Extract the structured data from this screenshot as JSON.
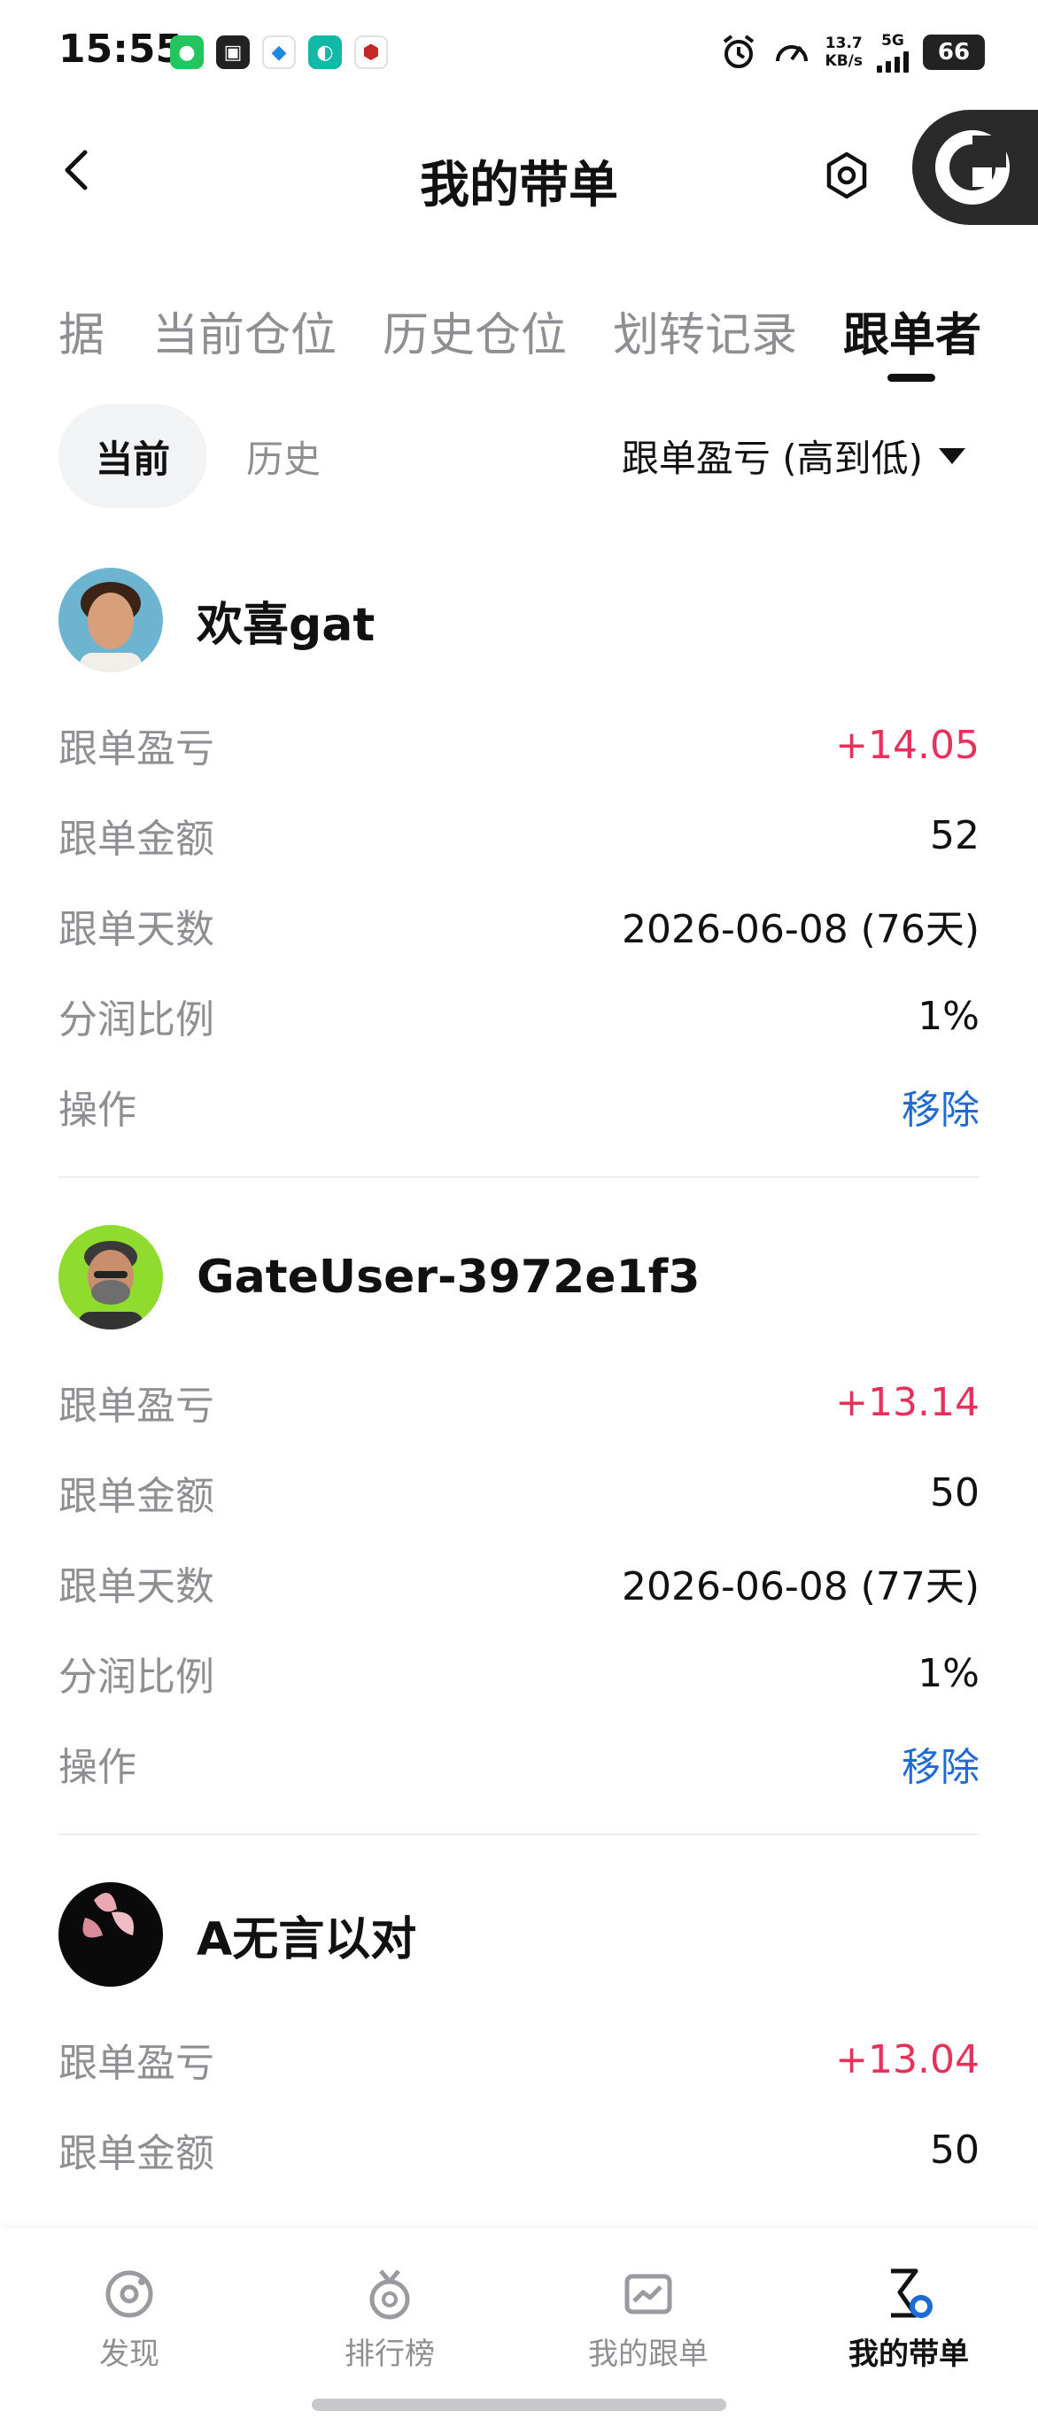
{
  "status_bar": {
    "time": "15:55",
    "net_speed_value": "13.7",
    "net_speed_unit": "KB/s",
    "network_type": "5G",
    "battery": "66"
  },
  "header": {
    "title": "我的带单"
  },
  "tabs": [
    {
      "label": "据"
    },
    {
      "label": "当前仓位"
    },
    {
      "label": "历史仓位"
    },
    {
      "label": "划转记录"
    },
    {
      "label": "跟单者"
    }
  ],
  "filter": {
    "current_label": "当前",
    "history_label": "历史",
    "sort_label": "跟单盈亏 (高到低)"
  },
  "followers": [
    {
      "name": "欢喜gat",
      "rows": [
        {
          "label": "跟单盈亏",
          "value": "+14.05"
        },
        {
          "label": "跟单金额",
          "value": "52"
        },
        {
          "label": "跟单天数",
          "value": "2026-06-08 (76天)"
        },
        {
          "label": "分润比例",
          "value": "1%"
        },
        {
          "label": "操作",
          "value": "移除"
        }
      ]
    },
    {
      "name": "GateUser-3972e1f3",
      "rows": [
        {
          "label": "跟单盈亏",
          "value": "+13.14"
        },
        {
          "label": "跟单金额",
          "value": "50"
        },
        {
          "label": "跟单天数",
          "value": "2026-06-08 (77天)"
        },
        {
          "label": "分润比例",
          "value": "1%"
        },
        {
          "label": "操作",
          "value": "移除"
        }
      ]
    },
    {
      "name": "A无言以对",
      "rows": [
        {
          "label": "跟单盈亏",
          "value": "+13.04"
        },
        {
          "label": "跟单金额",
          "value": "50"
        }
      ]
    }
  ],
  "bottom_nav": [
    {
      "label": "发现",
      "icon": "discover-icon"
    },
    {
      "label": "排行榜",
      "icon": "leaderboard-icon"
    },
    {
      "label": "我的跟单",
      "icon": "my-copy-icon"
    },
    {
      "label": "我的带单",
      "icon": "my-lead-icon"
    }
  ],
  "colors": {
    "profit": "#e8315a",
    "link": "#1e6bd6",
    "muted": "#8e8e93"
  }
}
